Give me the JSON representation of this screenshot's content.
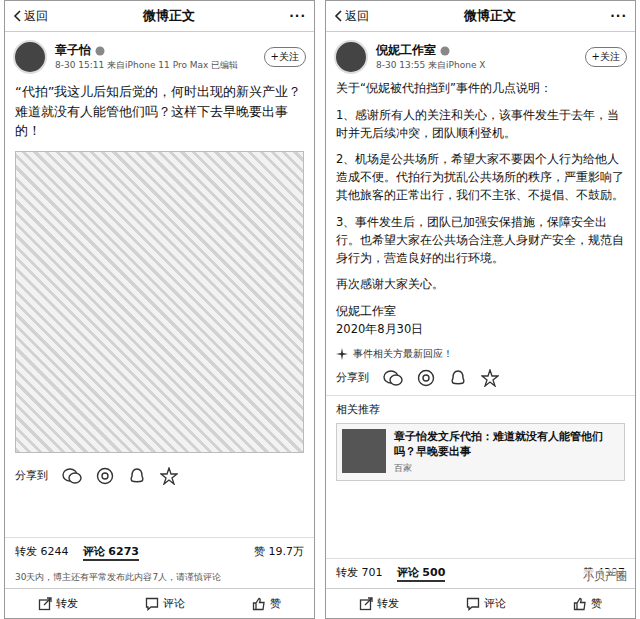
{
  "left": {
    "nav": {
      "back": "返回",
      "title": "微博正文",
      "more": "···"
    },
    "author": {
      "name": "章子怡",
      "meta": "8-30 15:11 来自iPhone 11 Pro Max 已编辑",
      "follow": "+关注"
    },
    "text": "“代拍”我这儿后知后觉的，何时出现的新兴产业？难道就没有人能管他们吗？这样下去早晚要出事的！",
    "share_label": "分享到",
    "stats": [
      {
        "label": "转发",
        "count": "6244",
        "selected": false
      },
      {
        "label": "评论",
        "count": "6273",
        "selected": true
      },
      {
        "label": "赞",
        "count": "19.7万",
        "selected": false
      }
    ],
    "notice": "30天内，博主还有平常发布此内容7人，请谨慎评论",
    "actions": [
      "转发",
      "评论",
      "赞"
    ]
  },
  "right": {
    "nav": {
      "back": "返回",
      "title": "微博正文",
      "more": "···"
    },
    "author": {
      "name": "倪妮工作室",
      "meta": "8-30 13:55 来自iPhone X",
      "follow": "+关注"
    },
    "paragraphs": [
      "关于“倪妮被代拍挡到”事件的几点说明：",
      "1、感谢所有人的关注和关心，该事件发生于去年，当时并无后续冲突，团队顺利登机。",
      "2、机场是公共场所，希望大家不要因个人行为给他人造成不便。代拍行为扰乱公共场所的秩序，严重影响了其他旅客的正常出行，我们不主张、不提倡、不鼓励。",
      "3、事件发生后，团队已加强安保措施，保障安全出行。也希望大家在公共场合注意人身财产安全，规范自身行为，营造良好的出行环境。",
      "再次感谢大家关心。"
    ],
    "signature": [
      "倪妮工作室",
      "2020年8月30日"
    ],
    "event_tag": "事件相关方最新回应！",
    "share_label": "分享到",
    "related": {
      "heading": "相关推荐",
      "title": "章子怡发文斥代拍：难道就没有人能管他们吗？早晚要出事",
      "source": "百家"
    },
    "stats": [
      {
        "label": "转发",
        "count": "701",
        "selected": false
      },
      {
        "label": "评论",
        "count": "500",
        "selected": true
      },
      {
        "label": "赞",
        "count": "4397",
        "selected": false
      }
    ],
    "actions": [
      "转发",
      "评论",
      "赞"
    ],
    "watermark": "小贝产圈"
  }
}
